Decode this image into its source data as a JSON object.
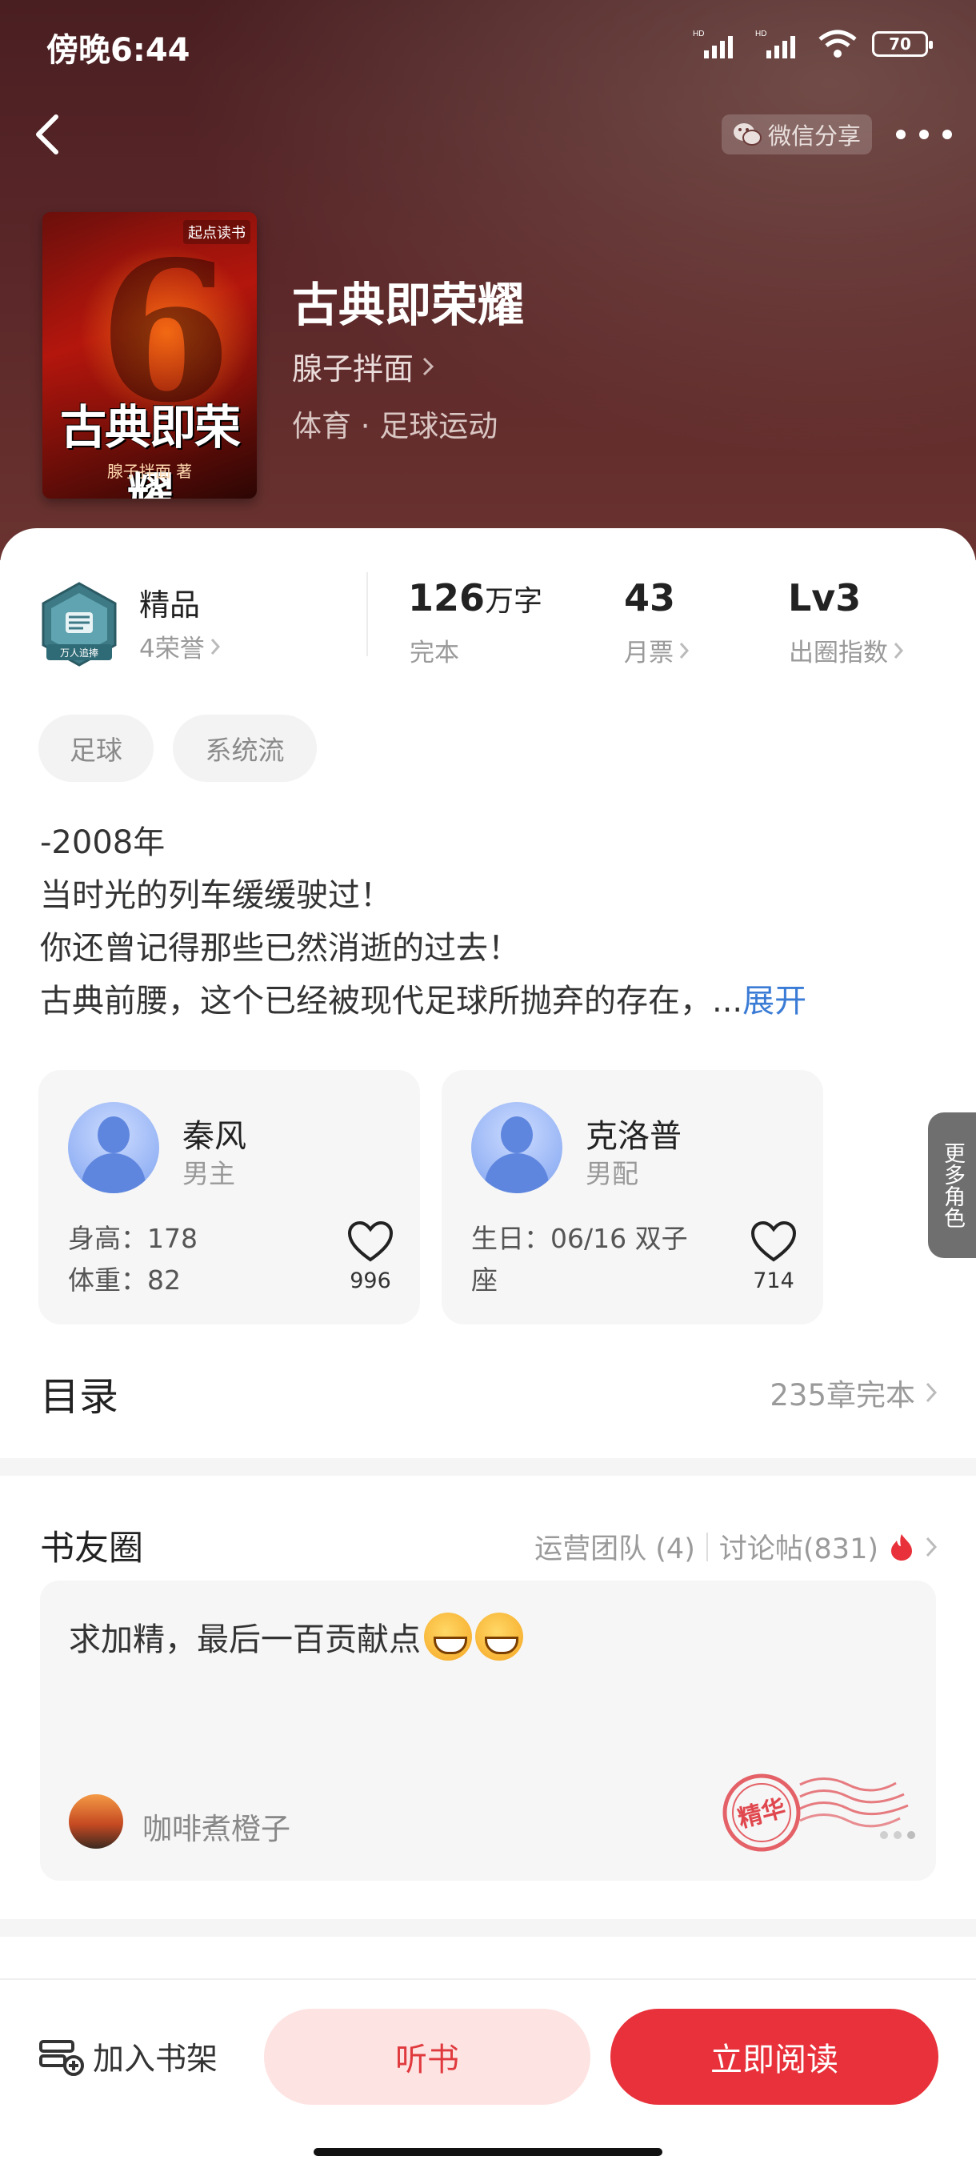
{
  "status": {
    "time": "傍晚6:44",
    "network_1": "HD",
    "network_2": "HD",
    "battery": "70"
  },
  "header": {
    "share_label": "微信分享"
  },
  "book": {
    "cover_brand": "起点读书",
    "cover_title": "古典即荣耀",
    "cover_author": "腺子拌面 著",
    "title": "古典即荣耀",
    "author": "腺子拌面",
    "genre": "体育 · 足球运动"
  },
  "stats": {
    "badge_label": "精品",
    "badge_sub": "4荣誉",
    "badge_ribbon": "万人追捧",
    "words_num": "126",
    "words_unit": "万字",
    "words_sub": "完本",
    "tickets_num": "43",
    "tickets_sub": "月票",
    "level_num": "Lv3",
    "level_sub": "出圈指数"
  },
  "tags": [
    "足球",
    "系统流"
  ],
  "description": {
    "lines": [
      "-2008年",
      "当时光的列车缓缓驶过！",
      "你还曾记得那些已然消逝的过去！",
      "古典前腰，这个已经被现代足球所抛弃的存在，..."
    ],
    "expand": "展开"
  },
  "characters": [
    {
      "name": "秦风",
      "role": "男主",
      "info_1": "身高：178",
      "info_2": "体重：82",
      "likes": "996"
    },
    {
      "name": "克洛普",
      "role": "男配",
      "info_1": "生日：06/16 双子",
      "info_2": "座",
      "likes": "714"
    }
  ],
  "more_roles": "更多角色",
  "toc": {
    "title": "目录",
    "status": "235章完本"
  },
  "club": {
    "title": "书友圈",
    "team": "运营团队 (4)",
    "posts": "讨论帖(831)",
    "post_text": "求加精，最后一百贡献点",
    "post_user": "咖啡煮橙子",
    "stamp_text": "精华"
  },
  "bottom": {
    "add_shelf": "加入书架",
    "listen": "听书",
    "read": "立即阅读"
  },
  "colors": {
    "accent_red": "#e8313a",
    "link_blue": "#3a7bd5",
    "hero_bg": "#5a2628"
  }
}
